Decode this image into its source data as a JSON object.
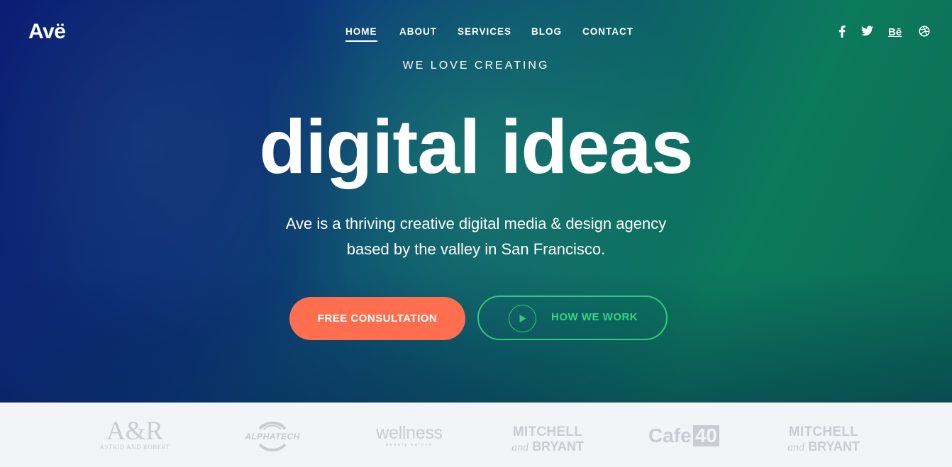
{
  "brand": {
    "logo_text": "Avë"
  },
  "nav": {
    "items": [
      {
        "label": "HOME",
        "active": true
      },
      {
        "label": "ABOUT"
      },
      {
        "label": "SERVICES"
      },
      {
        "label": "BLOG"
      },
      {
        "label": "CONTACT"
      }
    ]
  },
  "social": {
    "behance_text": "Bē"
  },
  "hero": {
    "eyebrow": "WE LOVE CREATING",
    "headline": "digital ideas",
    "subtext_line1": "Ave is a thriving creative digital media & design agency",
    "subtext_line2": "based by the valley in San Francisco.",
    "primary_button": "FREE CONSULTATION",
    "secondary_button": "HOW WE WORK"
  },
  "clients": {
    "ar_big": "A&R",
    "ar_small": "ASTRID AND ROBERT",
    "alphatech": "ALPHATECH",
    "wellness_big": "wellness",
    "wellness_small": "beauty saloon",
    "mb1_line1": "MITCHELL",
    "mb1_and": "and",
    "mb1_line2": "BRYANT",
    "cafe_text": "Cafe",
    "cafe_num": "40",
    "mb2_line1": "MITCHELL",
    "mb2_and": "and",
    "mb2_line2": "BRYANT"
  },
  "colors": {
    "primary_button": "#ff6f4f",
    "accent_green": "#33c97a",
    "logo_dots": "#f08a8a",
    "client_logo_gray": "#c9ccd3"
  }
}
